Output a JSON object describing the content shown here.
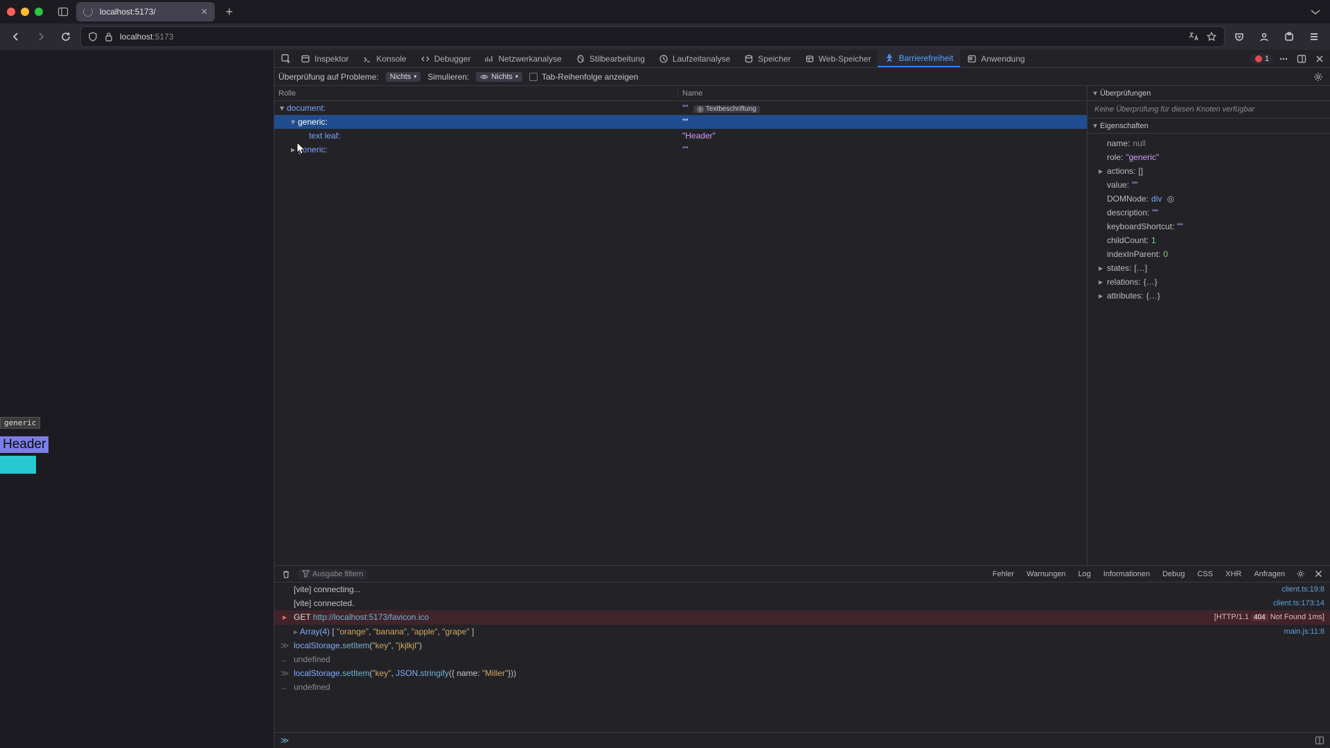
{
  "browser": {
    "tab_title": "localhost:5173/",
    "address_host": "localhost",
    "address_port": ":5173"
  },
  "devtools": {
    "tabs": [
      "Inspektor",
      "Konsole",
      "Debugger",
      "Netzwerkanalyse",
      "Stilbearbeitung",
      "Laufzeitanalyse",
      "Speicher",
      "Web-Speicher",
      "Barrierefreiheit",
      "Anwendung"
    ],
    "active_tab_index": 8,
    "error_count": "1"
  },
  "subbar": {
    "label_problems": "Überprüfung auf Probleme:",
    "val_problems": "Nichts",
    "label_simulate": "Simulieren:",
    "val_simulate": "Nichts",
    "checkbox_tab": "Tab-Reihenfolge anzeigen"
  },
  "tree_header": {
    "role": "Rolle",
    "name": "Name"
  },
  "tree": [
    {
      "indent": 0,
      "twisty": "▾",
      "role": "document:",
      "name_str": "\"\"",
      "badge": "Textbeschriftung",
      "sel": false
    },
    {
      "indent": 1,
      "twisty": "▾",
      "role": "generic:",
      "name_str": "\"\"",
      "sel": true
    },
    {
      "indent": 2,
      "twisty": "",
      "role": "text leaf:",
      "name_str": "\"Header\"",
      "sel": false
    },
    {
      "indent": 1,
      "twisty": "▸",
      "role": "generic:",
      "name_str": "\"\"",
      "sel": false
    }
  ],
  "side": {
    "checks_title": "Überprüfungen",
    "checks_msg": "Keine Überprüfung für diesen Knoten verfügbar",
    "props_title": "Eigenschaften",
    "props": [
      {
        "k": "name:",
        "v": "null",
        "cls": "pv-null",
        "exp": false
      },
      {
        "k": "role:",
        "v": "\"generic\"",
        "cls": "pv-str",
        "exp": false
      },
      {
        "k": "actions:",
        "v": "[]",
        "cls": "pv-obj",
        "exp": true
      },
      {
        "k": "value:",
        "v": "\"\"",
        "cls": "pv-str",
        "exp": false
      },
      {
        "k": "DOMNode:",
        "v": "div",
        "cls": "pv-node",
        "exp": false,
        "node": true
      },
      {
        "k": "description:",
        "v": "\"\"",
        "cls": "pv-str",
        "exp": false
      },
      {
        "k": "keyboardShortcut:",
        "v": "\"\"",
        "cls": "pv-str",
        "exp": false
      },
      {
        "k": "childCount:",
        "v": "1",
        "cls": "pv-num",
        "exp": false
      },
      {
        "k": "indexInParent:",
        "v": "0",
        "cls": "pv-num",
        "exp": false
      },
      {
        "k": "states:",
        "v": "[…]",
        "cls": "pv-obj",
        "exp": true
      },
      {
        "k": "relations:",
        "v": "{…}",
        "cls": "pv-obj",
        "exp": true
      },
      {
        "k": "attributes:",
        "v": "{…}",
        "cls": "pv-obj",
        "exp": true
      }
    ]
  },
  "console": {
    "filter_ph": "Ausgabe filtern",
    "buttons": [
      "Fehler",
      "Warnungen",
      "Log",
      "Informationen",
      "Debug",
      "CSS",
      "XHR",
      "Anfragen"
    ],
    "lines": [
      {
        "gutter": "",
        "body": "[vite] connecting...",
        "src": "client.ts:19:8"
      },
      {
        "gutter": "",
        "body": "[vite] connected.",
        "src": "client.ts:173:14"
      },
      {
        "gutter": "▸",
        "err": true,
        "body_html": "<span class='tok-prop'>GET </span><span class='tok-func'>http://localhost:5173/favicon.ico</span>",
        "src_html": "[HTTP/1.1 <span class='http-badge'>404</span> Not Found 1ms]"
      },
      {
        "gutter": "",
        "body_html": "<span class='arrow'>▸</span> <span class='tok-obj'>Array(4)</span> [ <span class='tok-str'>\"orange\"</span>, <span class='tok-str'>\"banana\"</span>, <span class='tok-str'>\"apple\"</span>, <span class='tok-str'>\"grape\"</span> ]",
        "src": "main.js:11:8"
      },
      {
        "gutter": "≫",
        "body_html": "<span class='tok-obj'>localStorage</span>.<span class='tok-func'>setItem</span>(<span class='tok-str'>\"key\"</span>, <span class='tok-str'>\"jkjlkjl\"</span>)"
      },
      {
        "gutter": "←",
        "body_html": "<span class='pv-null'>undefined</span>"
      },
      {
        "gutter": "≫",
        "body_html": "<span class='tok-obj'>localStorage</span>.<span class='tok-func'>setItem</span>(<span class='tok-str'>\"key\"</span>, <span class='tok-obj'>JSON</span>.<span class='tok-func'>stringify</span>({ name: <span class='tok-str'>\"Miller\"</span>}))"
      },
      {
        "gutter": "←",
        "body_html": "<span class='pv-null'>undefined</span>"
      }
    ]
  },
  "page_highlight": {
    "tag": "generic",
    "header": "Header"
  }
}
